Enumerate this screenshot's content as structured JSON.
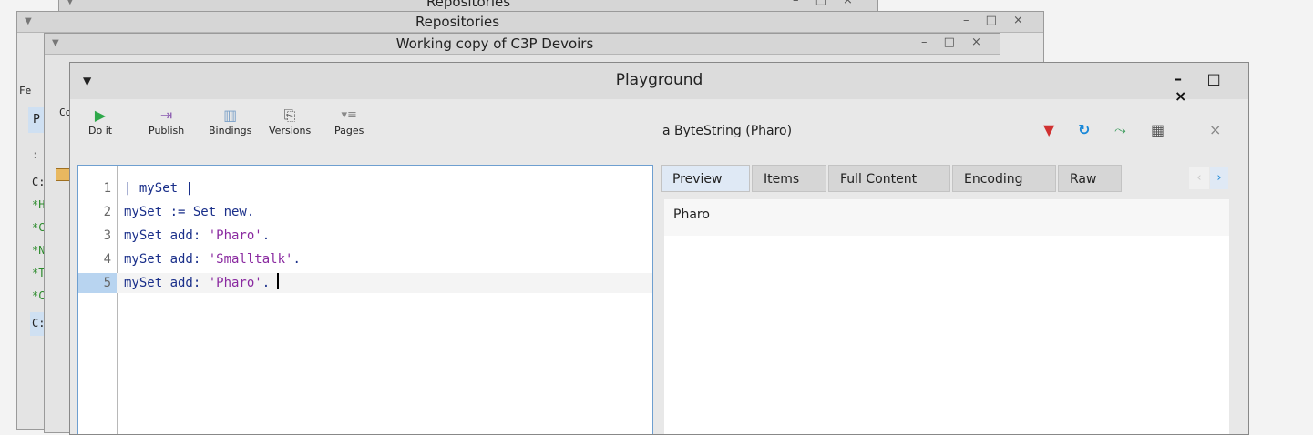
{
  "bg_windows": {
    "repos_back_title": "Repositories",
    "repos_title": "Repositories",
    "working_copy_title": "Working copy of C3P  Devoirs",
    "peek": {
      "fe": "Fe",
      "p": "P",
      "co": "Co",
      "colon": ":",
      "c1": "C:",
      "h": "*H",
      "c2": "*C",
      "n": "*N",
      "t": "*T",
      "c3": "*C",
      "c4": "C:"
    }
  },
  "main": {
    "title": "Playground",
    "controls": "– □ ×"
  },
  "toolbar": {
    "doit": "Do it",
    "publish": "Publish",
    "bindings": "Bindings",
    "versions": "Versions",
    "pages": "Pages"
  },
  "editor": {
    "lines": [
      {
        "num": "1",
        "code": "| mySet |"
      },
      {
        "num": "2",
        "code": "mySet := Set new."
      },
      {
        "num": "3",
        "code": "mySet add: ",
        "str": "'Pharo'",
        "end": "."
      },
      {
        "num": "4",
        "code": "mySet add: ",
        "str": "'Smalltalk'",
        "end": "."
      },
      {
        "num": "5",
        "code": "mySet add: ",
        "str": "'Pharo'",
        "end": "."
      }
    ]
  },
  "inspector": {
    "title": "a ByteString (Pharo)",
    "tabs": [
      "Preview",
      "Items",
      "Full Content",
      "Encoding",
      "Raw"
    ],
    "preview_value": "Pharo"
  },
  "colors": {
    "doit_icon": "#2ea84a",
    "accent_blue": "#1a88d8",
    "string": "#8a2aa0"
  }
}
